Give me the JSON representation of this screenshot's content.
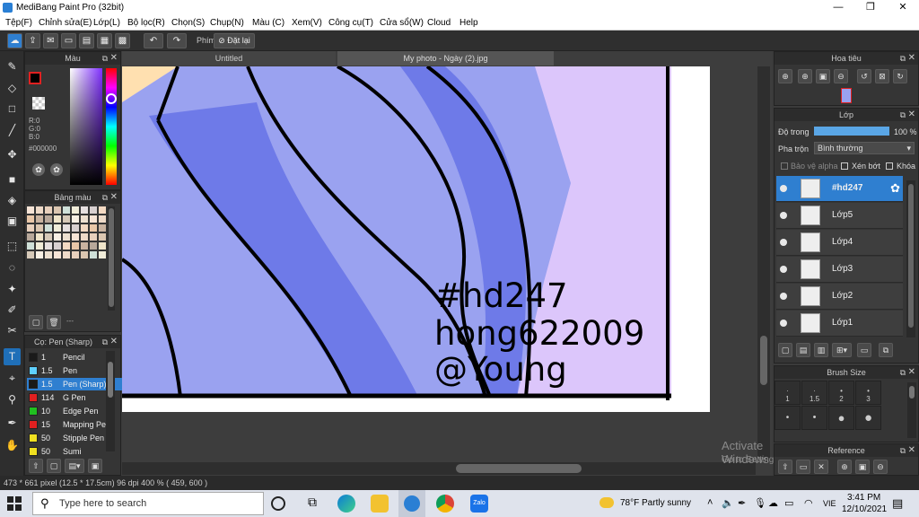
{
  "window": {
    "title": "MediBang Paint Pro (32bit)",
    "minimize": "—",
    "maximize": "❐",
    "close": "✕"
  },
  "menu": [
    "Tệp(F)",
    "Chỉnh sửa(E)",
    "Lớp(L)",
    "Bộ lọc(R)",
    "Chọn(S)",
    "Chụp(N)",
    "Màu (C)",
    "Xem(V)",
    "Công cụ(T)",
    "Cửa sổ(W)",
    "Cloud",
    "Help"
  ],
  "toolbar": {
    "shortcut_label": "Phím",
    "reset_label": "Đặt lại"
  },
  "color_panel": {
    "title": "Màu",
    "r": "R:0",
    "g": "G:0",
    "b": "B:0",
    "hex": "#000000"
  },
  "palette_panel": {
    "title": "Bảng màu",
    "footer": "---"
  },
  "brush_panel": {
    "title": "Cọ: Pen (Sharp)",
    "items": [
      {
        "size": "1",
        "name": "Pencil",
        "color": "#1a1a1a"
      },
      {
        "size": "1.5",
        "name": "Pen",
        "color": "#5fd0ff"
      },
      {
        "size": "1.5",
        "name": "Pen (Sharp)",
        "color": "#1a1a1a",
        "selected": true
      },
      {
        "size": "114",
        "name": "G Pen",
        "color": "#e02020"
      },
      {
        "size": "10",
        "name": "Edge Pen",
        "color": "#20c020"
      },
      {
        "size": "15",
        "name": "Mapping Pen",
        "color": "#e02020"
      },
      {
        "size": "50",
        "name": "Stipple Pen",
        "color": "#f0e020"
      },
      {
        "size": "50",
        "name": "Sumi",
        "color": "#f0e020"
      }
    ]
  },
  "tabs": {
    "untitled": "Untitled",
    "photo": "My photo - Ngày (2).jpg"
  },
  "canvas_text": {
    "line1": "#hd247",
    "line2": "hong622009",
    "line3": "@Young"
  },
  "navigator": {
    "title": "Hoa tiêu"
  },
  "layer_panel": {
    "title": "Lớp",
    "opacity_label": "Độ trong",
    "opacity_value": "100 %",
    "opacity": 1.0,
    "blend_label": "Pha trộn",
    "blend_value": "Bình thường",
    "protect_alpha": "Bảo vệ alpha",
    "clipping": "Xén bớt",
    "lock": "Khóa",
    "layers": [
      {
        "name": "#hd247",
        "selected": true
      },
      {
        "name": "Lớp5"
      },
      {
        "name": "Lớp4"
      },
      {
        "name": "Lớp3"
      },
      {
        "name": "Lớp2"
      },
      {
        "name": "Lớp1"
      }
    ]
  },
  "brush_size": {
    "title": "Brush Size",
    "sizes": [
      "1",
      "1.5",
      "2",
      "3"
    ]
  },
  "reference": {
    "title": "Reference"
  },
  "watermark": {
    "line1": "Activate Windows",
    "line2": "Go to Settings to activate Windows."
  },
  "status": {
    "text": "473 * 661 pixel  (12.5 * 17.5cm)  96 dpi  400 %  ( 459, 600 )"
  },
  "taskbar": {
    "search_placeholder": "Type here to search",
    "weather": "78°F  Partly sunny",
    "lang": "VIE",
    "time": "3:41 PM",
    "date": "12/10/2021"
  },
  "colors": {
    "accent": "#2f7fd0",
    "canvas_blue": "#9aa2f0",
    "canvas_dark_blue": "#6e7ae8",
    "canvas_lilac": "#dcc6fb",
    "skin": "#ffe0b0"
  }
}
